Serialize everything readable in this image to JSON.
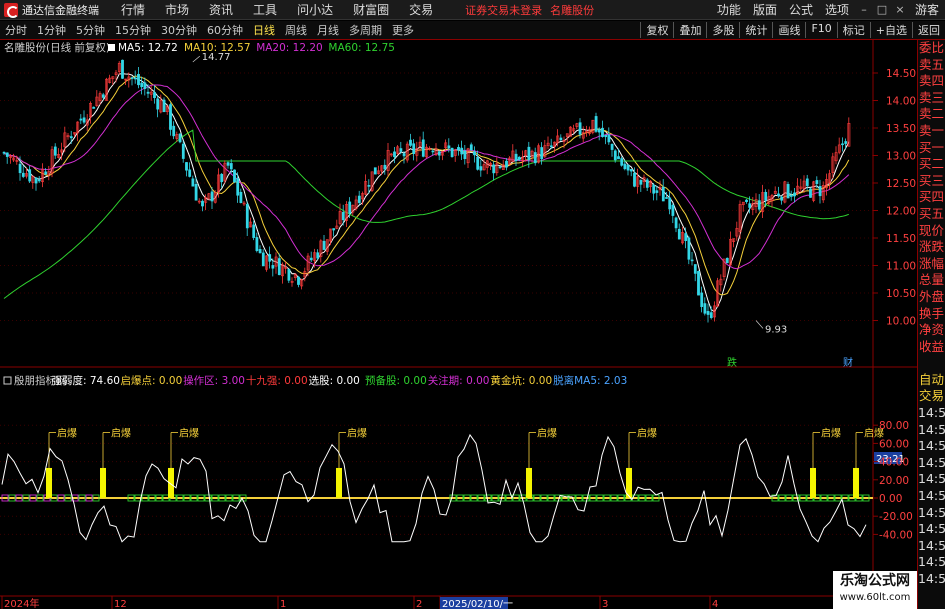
{
  "menubar": {
    "app_title": "通达信金融终端",
    "items": [
      "行情",
      "市场",
      "资讯",
      "工具",
      "问小达",
      "财富圈",
      "交易"
    ],
    "login_warning": "证券交易未登录",
    "stock_name": "名雕股份",
    "right_items": [
      "功能",
      "版面",
      "公式",
      "选项"
    ],
    "guest": "游客",
    "window_buttons": [
      "–",
      "□",
      "×"
    ]
  },
  "periods": {
    "items": [
      "分时",
      "1分钟",
      "5分钟",
      "15分钟",
      "30分钟",
      "60分钟",
      "日线",
      "周线",
      "月线",
      "多周期",
      "更多"
    ],
    "active_index": 6
  },
  "tools": [
    "复权",
    "叠加",
    "多股",
    "统计",
    "画线",
    "F10",
    "标记",
    "+自选",
    "返回"
  ],
  "main_chart": {
    "title": "名雕股份(日线 前复权)",
    "ma_legend": [
      {
        "label": "MA5: 12.72",
        "color": "#ffffff"
      },
      {
        "label": "MA10: 12.57",
        "color": "#f5d03a"
      },
      {
        "label": "MA20: 12.20",
        "color": "#d22fd2"
      },
      {
        "label": "MA60: 12.75",
        "color": "#2fd22f"
      }
    ],
    "y_ticks": [
      "14.50",
      "14.00",
      "13.50",
      "13.00",
      "12.50",
      "12.00",
      "11.50",
      "11.00",
      "10.50",
      "10.00"
    ],
    "high_label": "14.77",
    "low_label": "9.93",
    "tag_die": "跌",
    "tag_cai": "财"
  },
  "indicator": {
    "legend": [
      {
        "label": "殷朋指标网",
        "color": "#cccccc"
      },
      {
        "label": "强弱度: 74.60",
        "color": "#ffffff"
      },
      {
        "label": "启爆点: 0.00",
        "color": "#f5d03a"
      },
      {
        "label": "操作区: 3.00",
        "color": "#d22fd2"
      },
      {
        "label": "十九强: 0.00",
        "color": "#ff3b3b"
      },
      {
        "label": "选股: 0.00",
        "color": "#ffffff"
      },
      {
        "label": "预备股: 0.00",
        "color": "#2fd22f"
      },
      {
        "label": "关注期: 0.00",
        "color": "#d22fd2"
      },
      {
        "label": "黄金坑: 0.00",
        "color": "#f5d03a"
      },
      {
        "label": "脱离MA5: 2.03",
        "color": "#4aa3ff"
      }
    ],
    "y_ticks": [
      "80.00",
      "60.00",
      "40.00",
      "20.00",
      "0.00",
      "-20.00",
      "-40.00"
    ],
    "signal_label": "启爆"
  },
  "date_axis": {
    "labels": [
      "2024年",
      "12",
      "1",
      "2",
      "2025/02/10/一",
      "3",
      "4"
    ]
  },
  "right_panel": {
    "items": [
      "委比",
      "卖五",
      "卖四",
      "卖三",
      "卖二",
      "卖一",
      "买一",
      "买二",
      "买三",
      "买四",
      "买五",
      "现价",
      "涨跌",
      "涨幅",
      "总量",
      "外盘",
      "换手",
      "净资",
      "收益",
      "",
      "自动",
      "交易",
      "14:55",
      "14:56",
      "14:56",
      "14:56",
      "14:56",
      "14:56",
      "14:56",
      "14:56",
      "14:56",
      "14:56",
      "14:56"
    ],
    "time_highlight": "23:21"
  },
  "watermark": {
    "line1": "乐淘公式网",
    "line2": "www.60lt.com"
  }
}
